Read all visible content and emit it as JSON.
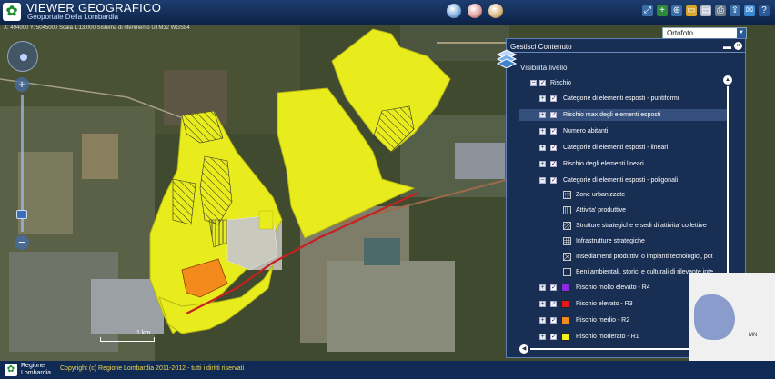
{
  "header": {
    "title": "VIEWER GEOGRAFICO",
    "subtitle": "Geoportale Della Lombardia"
  },
  "map": {
    "coords_text": "X: 494000 Y: 5045000 Scala 1:13.000 Sistema di riferimento UTM32 WGS84",
    "scale_label": "1 km",
    "basemap_value": "Ortofoto"
  },
  "panel": {
    "title": "Gestisci Contenuto",
    "visibility_label": "Visibilità livello",
    "root": "Rischio",
    "groups": [
      {
        "label": "Categorie di elementi esposti - puntiformi"
      },
      {
        "label": "Rischio max degli elementi esposti"
      },
      {
        "label": "Numero abitanti"
      },
      {
        "label": "Categorie di elementi esposti - lineari"
      },
      {
        "label": "Rischio degli elementi lineari"
      },
      {
        "label": "Categorie di elementi esposti - poligonali"
      }
    ],
    "legend": [
      {
        "label": "Zone urbanizzate",
        "symbol": "dense-dots"
      },
      {
        "label": "Attivita' produttive",
        "symbol": "vertical-lines"
      },
      {
        "label": "Strutture strategiche e sedi di attivita' collettive",
        "symbol": "diagonal-lines"
      },
      {
        "label": "Infrastrutture strategiche",
        "symbol": "grid"
      },
      {
        "label": "Insediamenti produttivi o impianti tecnologici, pot",
        "symbol": "cross-hatch"
      },
      {
        "label": "Beni ambientali, storici e culturali di rilevante inte",
        "symbol": "empty"
      }
    ],
    "risk_layers": [
      {
        "label": "Rischio molto elevato - R4",
        "color": "#8a2be2"
      },
      {
        "label": "Rischio elevato - R3",
        "color": "#e11a1a"
      },
      {
        "label": "Rischio medio - R2",
        "color": "#f28a1c"
      },
      {
        "label": "Rischio moderato - R1",
        "color": "#f4f01a"
      }
    ]
  },
  "overview": {
    "label": "MN"
  },
  "footer": {
    "logo_line1": "Regione",
    "logo_line2": "Lombardia",
    "copyright": "Copyright (c) Regione Lombardia 2011-2012 - tutti i diritti riservati"
  },
  "colors": {
    "header_bg": "#1d3d6e",
    "panel_bg": "#162c56",
    "risk_yellow": "#e8eb1c",
    "risk_orange": "#f28a1c",
    "footer_text": "#f4d84a"
  }
}
